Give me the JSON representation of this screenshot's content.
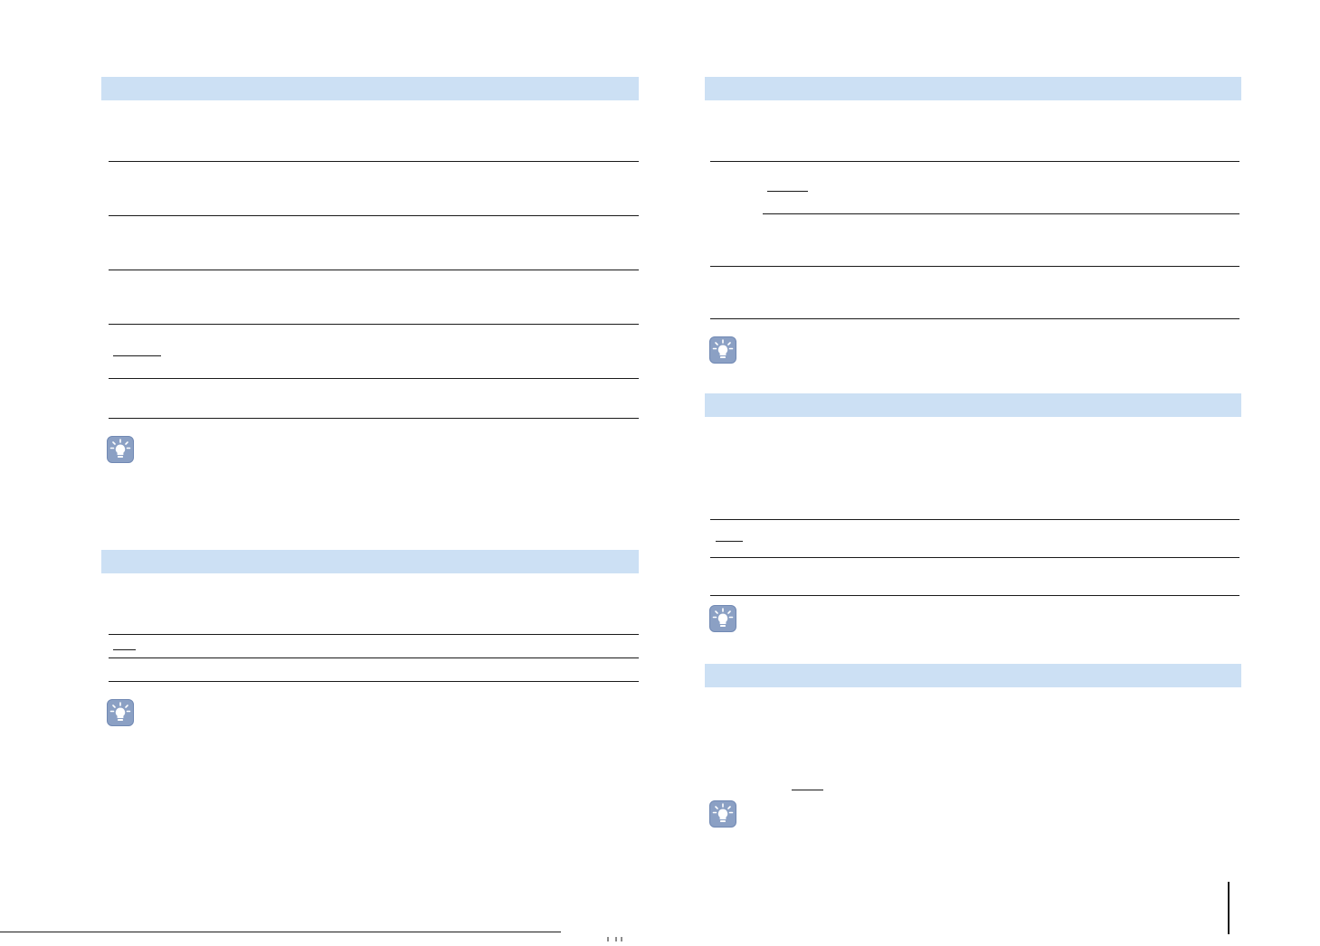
{
  "colors": {
    "section_band": "#cce0f4",
    "rule": "#1a1a1a",
    "tip_icon": "#8ba0c4"
  },
  "icons": [
    "lightbulb-tip-icon"
  ],
  "left_column": {
    "sections": [
      {
        "header": "",
        "rows": 5,
        "has_tip": true
      },
      {
        "header": "",
        "rows": 2,
        "has_tip": true
      }
    ]
  },
  "right_column": {
    "sections": [
      {
        "header": "",
        "rows": 3,
        "has_tip": true
      },
      {
        "header": "",
        "rows": 2,
        "has_tip": true
      },
      {
        "header": "",
        "rows": 0,
        "has_tip": true
      }
    ]
  }
}
